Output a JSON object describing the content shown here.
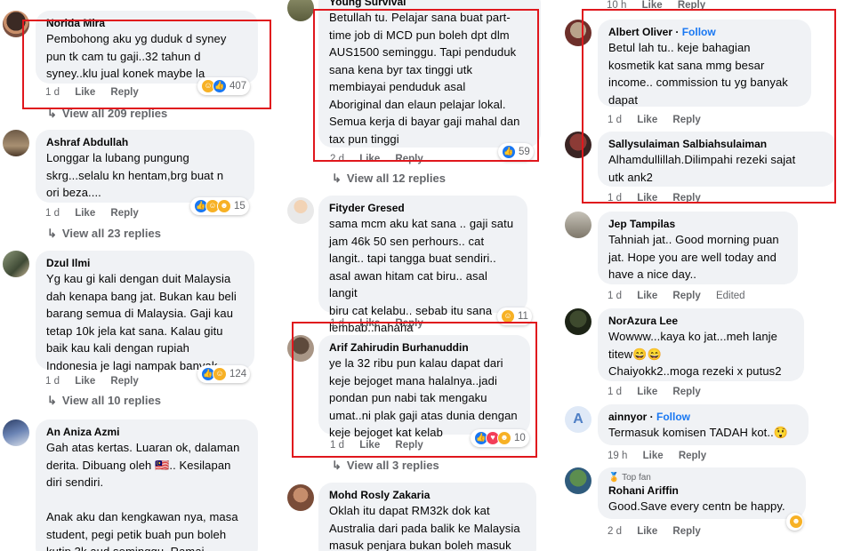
{
  "col1": {
    "c1": {
      "name": "Norida Mira",
      "text": "Pembohong aku yg duduk d syney\npun tk cam tu gaji..32 tahun d\nsyney..klu jual konek maybe la",
      "time": "1 d",
      "like": "Like",
      "reply": "Reply",
      "reactions": "407",
      "view": "View all 209 replies"
    },
    "c2": {
      "name": "Ashraf Abdullah",
      "text": "Longgar la lubang pungung\nskrg...selalu kn hentam,brg buat n\nori beza....",
      "time": "1 d",
      "like": "Like",
      "reply": "Reply",
      "reactions": "15",
      "view": "View all 23 replies"
    },
    "c3": {
      "name": "Dzul Ilmi",
      "text": "Yg kau gi kali dengan duit Malaysia\ndah kenapa bang jat. Bukan kau beli\nbarang semua di Malaysia. Gaji kau\ntetap 10k jela kat sana. Kalau gitu\nbaik kau kali dengan rupiah\nIndonesia je lagi nampak banyak.",
      "time": "1 d",
      "like": "Like",
      "reply": "Reply",
      "reactions": "124",
      "view": "View all 10 replies"
    },
    "c4": {
      "name": "An Aniza Azmi",
      "text": "Gah atas kertas. Luaran ok, dalaman\nderita. Dibuang oleh 🇲🇾.. Kesilapan\ndiri sendiri.\n\nAnak aku dan kengkawan nya, masa\nstudent, pegi petik buah pun boleh\nkutip 3k aud seminggu. Ramai\norang Perak di Melbourne. Kekaya"
    }
  },
  "col2": {
    "c1": {
      "name": "Young Survival",
      "text": "Betullah tu. Pelajar sana buat part-\ntime job di MCD pun boleh dpt dlm\nAUS1500 seminggu. Tapi penduduk\nsana kena byr tax tinggi utk\nmembiayai penduduk asal\nAboriginal dan elaun pelajar lokal.\nSemua kerja di bayar gaji mahal dan\ntax pun tinggi",
      "time": "2 d",
      "like": "Like",
      "reply": "Reply",
      "reactions": "59",
      "view": "View all 12 replies"
    },
    "c2": {
      "name": "Fityder Gresed",
      "text": "sama mcm aku kat sana .. gaji satu\njam 46k 50 sen perhours.. cat\nlangit.. tapi tangga buat sendiri..\nasal awan hitam cat biru.. asal langit\nbiru cat kelabu.. sebab itu sana\nlembab..hahaha",
      "time": "1 d",
      "like": "Like",
      "reply": "Reply",
      "reactions": "11"
    },
    "c3": {
      "name": "Arif Zahirudin Burhanuddin",
      "text": "ye la 32 ribu pun kalau dapat dari\nkeje bejoget mana halalnya..jadi\npondan pun nabi tak mengaku\numat..ni plak gaji atas dunia dengan\nkeje bejoget kat kelab",
      "time": "1 d",
      "like": "Like",
      "reply": "Reply",
      "reactions": "10",
      "view": "View all 3 replies"
    },
    "c4": {
      "name": "Mohd Rosly Zakaria",
      "text": "Oklah itu dapat RM32k dok kat\nAustralia dari pada balik ke Malaysia\nmasuk penjara bukan boleh masuk"
    }
  },
  "col3": {
    "c0": {
      "time": "10 h",
      "like": "Like",
      "reply": "Reply"
    },
    "c1": {
      "name": "Albert Oliver",
      "follow": "Follow",
      "text": "Betul lah tu.. keje bahagian\nkosmetik kat sana mmg besar\nincome.. commission tu yg banyak\ndapat",
      "time": "1 d",
      "like": "Like",
      "reply": "Reply"
    },
    "c2": {
      "name": "Sallysulaiman Salbiahsulaiman",
      "text": "Alhamdullillah.Dilimpahi rezeki sajat\nutk ank2",
      "time": "1 d",
      "like": "Like",
      "reply": "Reply"
    },
    "c3": {
      "name": "Jep Tampilas",
      "text": "Tahniah jat.. Good morning puan\njat. Hope you are well today and\nhave a nice day..",
      "time": "1 d",
      "like": "Like",
      "reply": "Reply",
      "edited": "Edited"
    },
    "c4": {
      "name": "NorAzura Lee",
      "text": "Wowww...kaya ko jat...meh lanje\ntitew😄😄\nChaiyokk2..moga rezeki x putus2",
      "time": "1 d",
      "like": "Like",
      "reply": "Reply"
    },
    "c5": {
      "name": "ainnyor",
      "follow": "Follow",
      "text": "Termasuk komisen TADAH kot..😲",
      "time": "19 h",
      "like": "Like",
      "reply": "Reply",
      "avatar_letter": "A"
    },
    "c6": {
      "badge": "Top fan",
      "name": "Rohani Ariffin",
      "text": "Good.Save every centn be happy.",
      "time": "2 d",
      "like": "Like",
      "reply": "Reply"
    }
  },
  "colors": {
    "accent": "#1877f2",
    "highlight": "#e0171d",
    "bubble": "#f0f2f5",
    "meta": "#65676b"
  },
  "icons": [
    "reply-arrow-icon",
    "like-reaction-icon",
    "haha-reaction-icon",
    "love-reaction-icon",
    "care-reaction-icon",
    "follow-dot-icon"
  ]
}
